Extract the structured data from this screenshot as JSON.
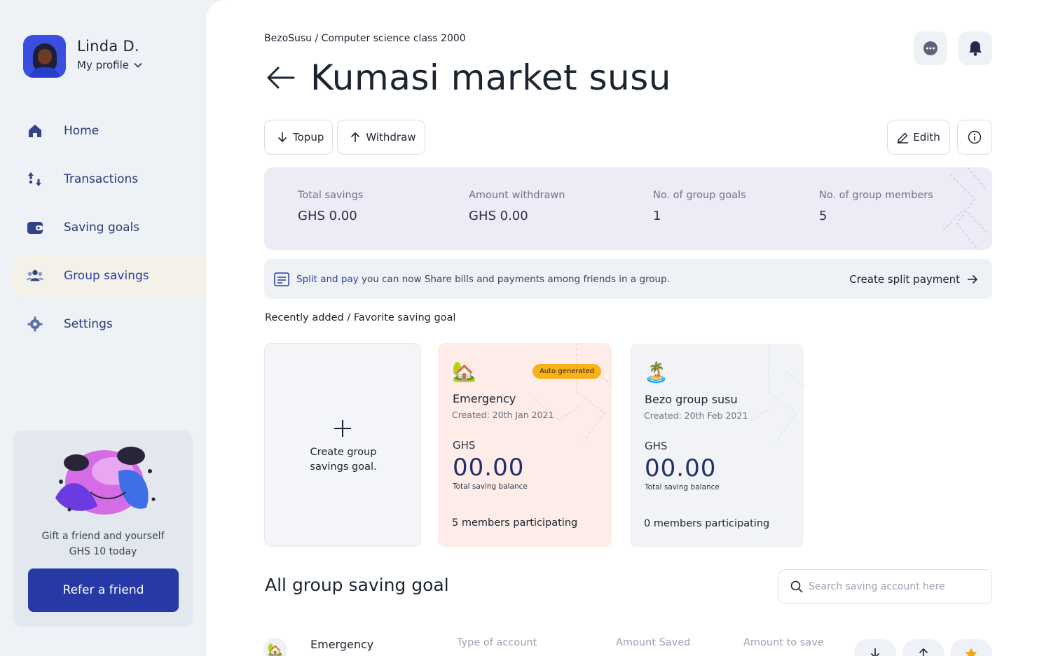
{
  "profile": {
    "name": "Linda D.",
    "link_label": "My profile"
  },
  "nav": {
    "items": [
      {
        "label": "Home",
        "icon": "home-icon"
      },
      {
        "label": "Transactions",
        "icon": "transactions-icon"
      },
      {
        "label": "Saving goals",
        "icon": "wallet-icon"
      },
      {
        "label": "Group savings",
        "icon": "group-icon",
        "active": true
      },
      {
        "label": "Settings",
        "icon": "gear-icon"
      }
    ]
  },
  "promo": {
    "line1": "Gift a friend and yourself",
    "line2": "GHS 10 today",
    "button_label": "Refer a friend"
  },
  "header": {
    "breadcrumb": "BezoSusu / Computer science class 2000",
    "title": "Kumasi market susu",
    "icons": [
      "chat-icon",
      "bell-icon"
    ]
  },
  "actions": {
    "topup_label": "Topup",
    "withdraw_label": "Withdraw",
    "edit_label": "Edith"
  },
  "stats": [
    {
      "label": "Total savings",
      "value": "GHS 0.00"
    },
    {
      "label": "Amount withdrawn",
      "value": "GHS 0.00"
    },
    {
      "label": "No. of group goals",
      "value": "1"
    },
    {
      "label": "No. of group members",
      "value": "5"
    }
  ],
  "banner": {
    "highlight": "Split and pay",
    "text": " you can now Share bills and payments among friends in a group.",
    "cta": "Create split payment"
  },
  "section_label": "Recently added / Favorite saving goal",
  "create_card": {
    "line1": "Create group",
    "line2": "savings goal."
  },
  "goal_cards": [
    {
      "emoji": "🏡",
      "badge": "Auto generated",
      "name": "Emergency",
      "created": "Created: 20th Jan 2021",
      "currency": "GHS",
      "amount": "00.00",
      "sub": "Total saving balance",
      "members": "5 members participating"
    },
    {
      "emoji": "🏝️",
      "name": "Bezo group susu",
      "created": "Created: 20th Feb 2021",
      "currency": "GHS",
      "amount": "00.00",
      "sub": "Total saving balance",
      "members": "0 members participating"
    }
  ],
  "all_goals": {
    "title": "All group saving goal",
    "search_placeholder": "Search saving account here",
    "columns": [
      "Type of account",
      "Amount Saved",
      "Amount to save"
    ],
    "rows": [
      {
        "emoji": "🏡",
        "name": "Emergency"
      }
    ]
  },
  "colors": {
    "accent": "#2639a6",
    "badge": "#f7b21b",
    "stats_bg": "#eeeaf6",
    "emergency_bg": "#fdece8"
  }
}
